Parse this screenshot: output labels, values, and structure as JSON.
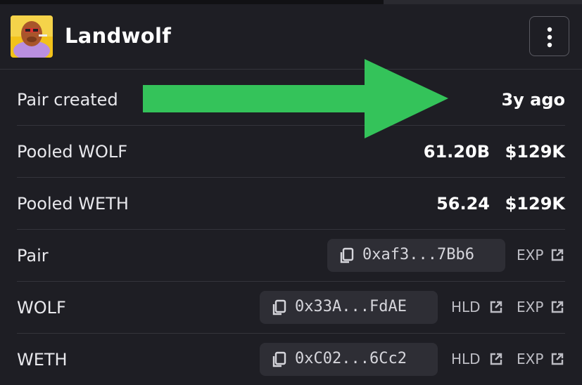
{
  "header": {
    "title": "Landwolf",
    "menu_icon": "kebab-menu-icon"
  },
  "rows": [
    {
      "label": "Pair created",
      "value": "3y ago"
    },
    {
      "label": "Pooled WOLF",
      "amount": "61.20B",
      "usd": "$129K"
    },
    {
      "label": "Pooled WETH",
      "amount": "56.24",
      "usd": "$129K"
    },
    {
      "label": "Pair",
      "address": "0xaf3...7Bb6",
      "links": [
        "EXP"
      ]
    },
    {
      "label": "WOLF",
      "address": "0x33A...FdAE",
      "links": [
        "HLD",
        "EXP"
      ]
    },
    {
      "label": "WETH",
      "address": "0xC02...6Cc2",
      "links": [
        "HLD",
        "EXP"
      ]
    }
  ],
  "colors": {
    "background": "#1e1e24",
    "divider": "#34343b",
    "address_bg": "#2e2e35",
    "arrow": "#34c35a"
  }
}
